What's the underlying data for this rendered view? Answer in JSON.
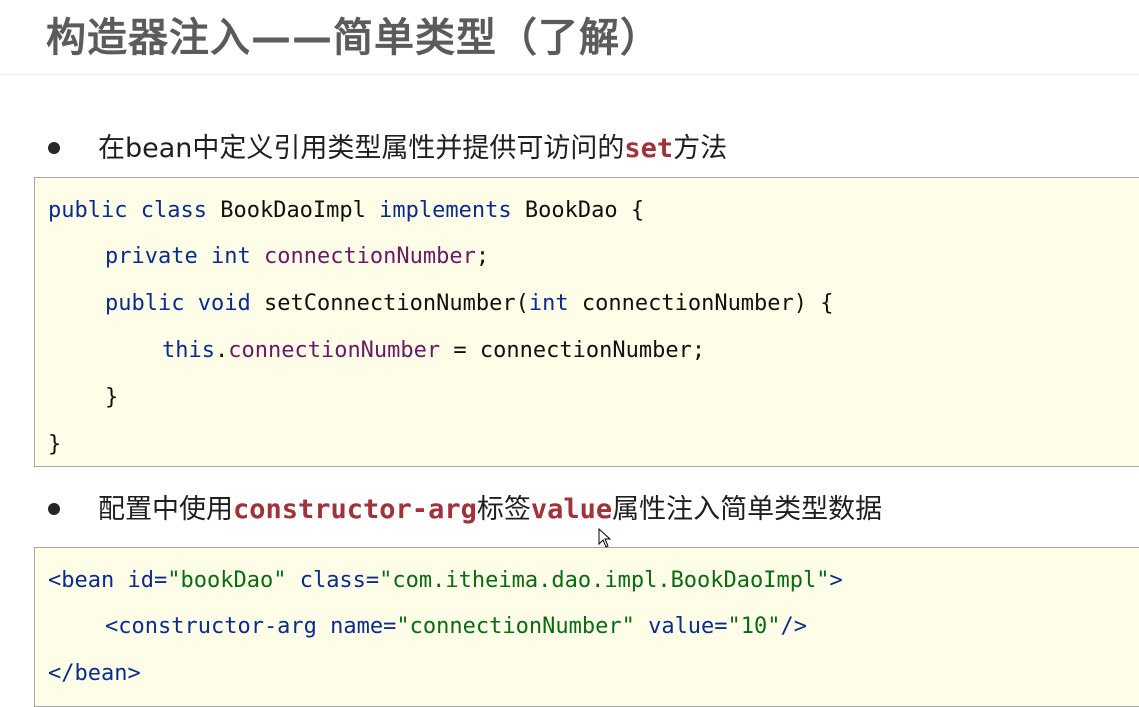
{
  "title": "构造器注入——简单类型（了解）",
  "bullet1": {
    "before": "在bean中定义引用类型属性并提供可访问的",
    "kw": "set",
    "after": "方法"
  },
  "bullet2": {
    "before": "配置中使用",
    "kw1": "constructor-arg",
    "mid": "标签",
    "kw2": "value",
    "after": "属性注入简单类型数据"
  },
  "java": {
    "l1_public": "public",
    "l1_class": "class",
    "l1_name": " BookDaoImpl ",
    "l1_impl": "implements",
    "l1_rest": " BookDao {",
    "l2_private": "private",
    "l2_int": "int",
    "l2_field": "connectionNumber",
    "l2_end": ";",
    "l3_public": "public",
    "l3_void": "void",
    "l3_method": " setConnectionNumber(",
    "l3_int": "int",
    "l3_rest": " connectionNumber) {",
    "l4_this": "this",
    "l4_dot": ".",
    "l4_field": "connectionNumber",
    "l4_rest": " = connectionNumber;",
    "l5": "}",
    "l6": "}"
  },
  "xml": {
    "l1_open": "<bean ",
    "l1_id": "id=",
    "l1_idv": "\"bookDao\"",
    "l1_class": " class=",
    "l1_classv": "\"com.itheima.dao.impl.BookDaoImpl\"",
    "l1_close": ">",
    "l2_open": "<constructor-arg ",
    "l2_name": "name=",
    "l2_namev": "\"connectionNumber\"",
    "l2_value": " value=",
    "l2_valuev": "\"10\"",
    "l2_close": "/>",
    "l3": "</bean>"
  }
}
